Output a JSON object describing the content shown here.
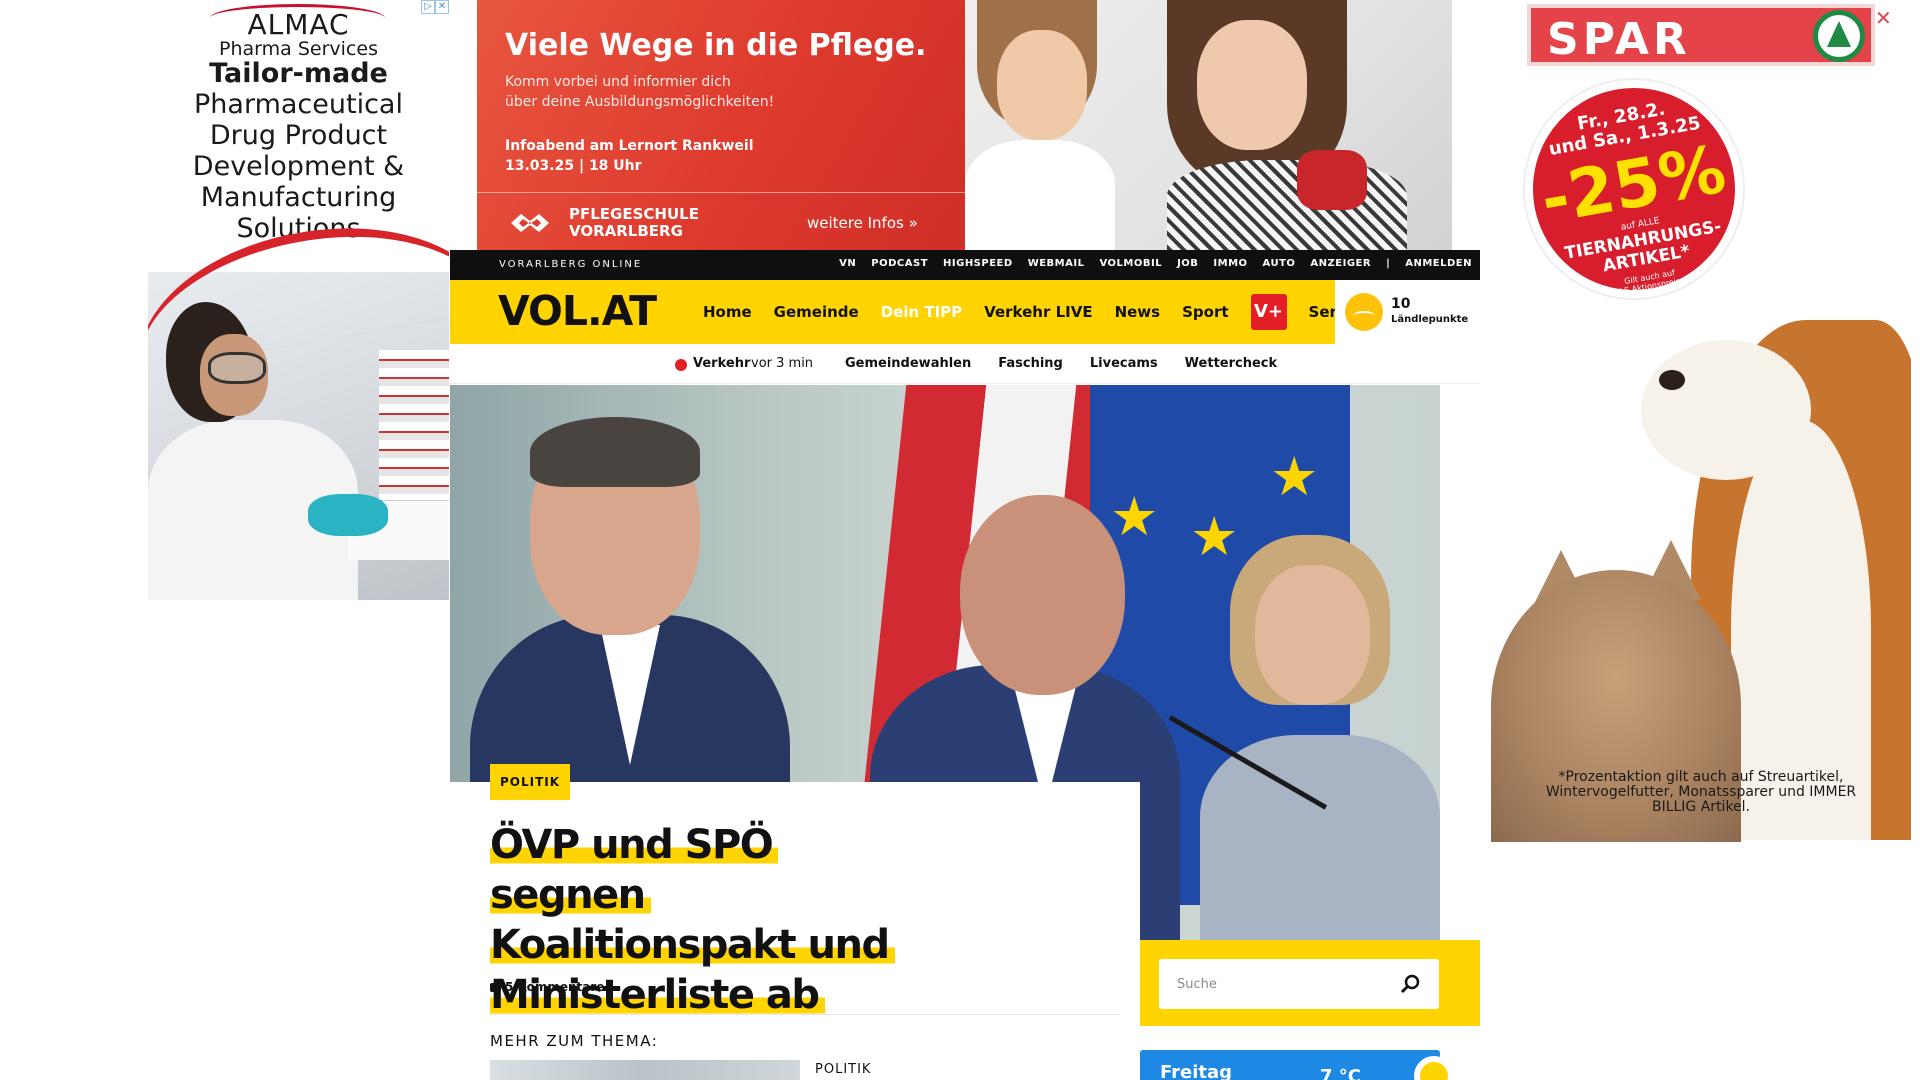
{
  "ad_left": {
    "adchoices": [
      "▷",
      "✕"
    ],
    "brand": "ALMAC",
    "brand_sub": "Pharma Services",
    "headline_bold": "Tailor-made",
    "headline_rest": [
      "Pharmaceutical",
      "Drug Product",
      "Development &",
      "Manufacturing",
      "Solutions"
    ]
  },
  "ad_top": {
    "title": "Viele Wege in die Pflege.",
    "sub_line1": "Komm vorbei und informier dich",
    "sub_line2": "über deine Ausbildungsmöglichkeiten!",
    "event_line1": "Infoabend am Lernort Rankweil",
    "event_line2": "13.03.25 | 18 Uhr",
    "logo_line1": "PFLEGESCHULE",
    "logo_line2": "VORARLBERG",
    "more": "weitere Infos »"
  },
  "ad_right": {
    "brand": "SPAR",
    "close": "✕",
    "badge_date1": "Fr., 28.2.",
    "badge_date2": "und Sa., 1.3.25",
    "badge_pct": "-25%",
    "badge_small": "auf ALLE",
    "badge_cat1": "TIERNAHRUNGS-",
    "badge_cat2": "ARTIKEL*",
    "badge_fine1": "Gilt auch auf",
    "badge_fine2": "ALLE Aktionspreise!*",
    "fineprint": "*Prozentaktion gilt auch auf Streuartikel, Wintervogelfutter, Monatssparer und IMMER BILLIG Artikel."
  },
  "topbar": {
    "network": "VORARLBERG ONLINE",
    "links": [
      "VN",
      "PODCAST",
      "HIGHSPEED",
      "WEBMAIL",
      "VOLMOBIL",
      "JOB",
      "IMMO",
      "AUTO",
      "ANZEIGER",
      "|",
      "ANMELDEN"
    ]
  },
  "mainnav": {
    "logo": "VOL.AT",
    "items": [
      "Home",
      "Gemeinde",
      "Dein TIPP",
      "Verkehr LIVE",
      "News",
      "Sport"
    ],
    "vplus": "V+",
    "service": "Service",
    "points_value": "10",
    "points_label": "Ländlepunkte"
  },
  "subnav": {
    "verkehr": "Verkehr",
    "ago": "vor 3 min",
    "tags": [
      "Gemeindewahlen",
      "Fasching",
      "Livecams",
      "Wettercheck"
    ]
  },
  "article": {
    "category": "POLITIK",
    "headline": [
      "ÖVP und SPÖ segnen",
      "Koalitionspakt und",
      "Ministerliste ab"
    ],
    "comments": "5 Kommentare",
    "more_label": "MEHR ZUM THEMA:",
    "related_category": "POLITIK"
  },
  "search": {
    "placeholder": "Suche"
  },
  "weather": {
    "day": "Freitag",
    "temp": "7 °C"
  },
  "colors": {
    "vol_yellow": "#ffd400",
    "vplus_red": "#e31e24",
    "spar_red": "#e5434a",
    "weather_blue": "#1e88e5"
  }
}
